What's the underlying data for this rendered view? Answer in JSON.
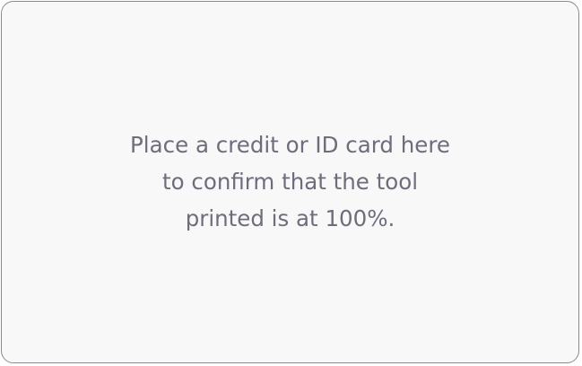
{
  "card_guide": {
    "instruction": "Place a credit or ID card here\nto confirm that the tool\nprinted is at 100%."
  }
}
